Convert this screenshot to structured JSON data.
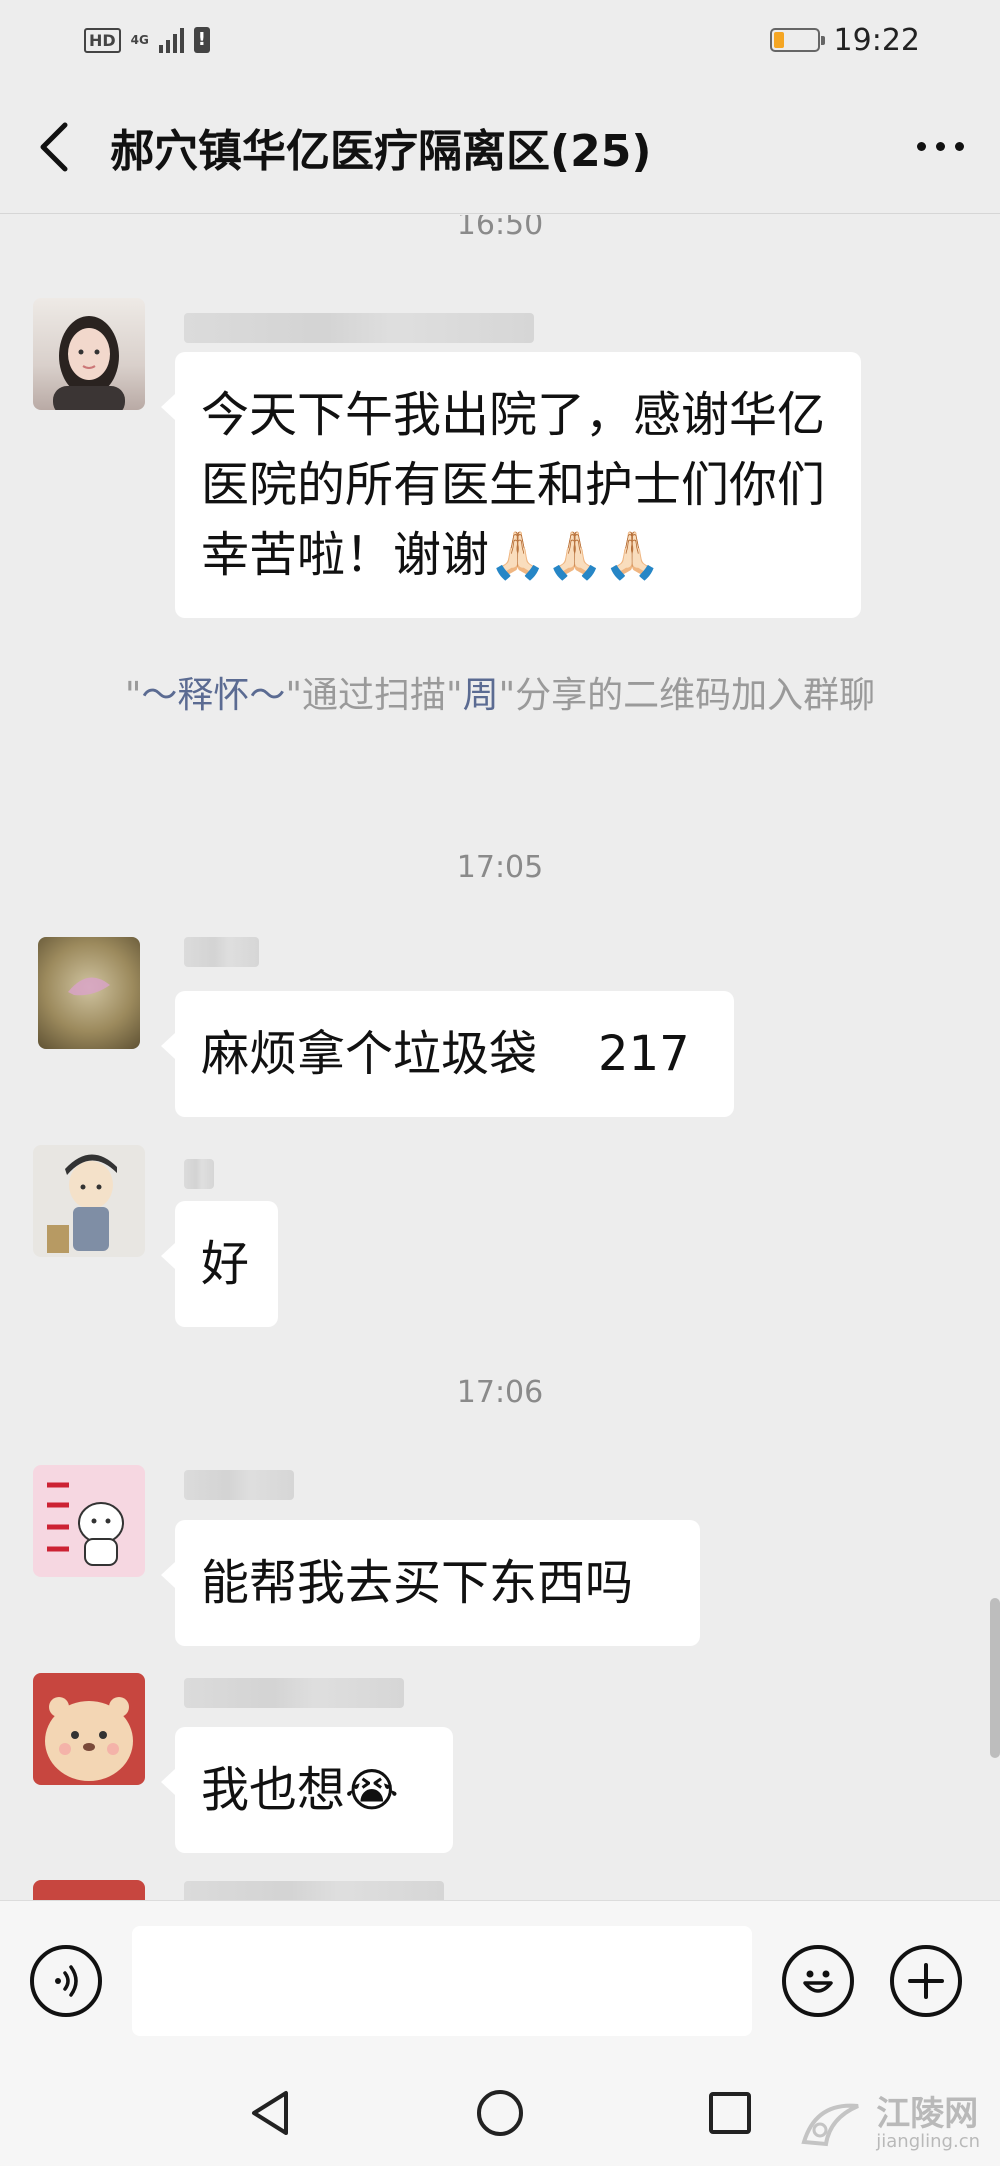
{
  "status_bar": {
    "hd": "HD",
    "network": "4G",
    "warning": "!",
    "time": "19:22",
    "battery_level": 0.25,
    "battery_color": "#f5a623"
  },
  "header": {
    "title": "郝穴镇华亿医疗隔离区(25)",
    "back_icon": "chevron-left-icon",
    "more_icon": "more-dots-icon"
  },
  "messages": {
    "time1": "16:50",
    "msg1": {
      "text": "今天下午我出院了，感谢华亿医院的所有医生和护士们你们幸苦啦！谢谢",
      "emoji": "🙏🏻🙏🏻🙏🏻"
    },
    "system": {
      "q1": "\"",
      "name1": "～释怀～",
      "q2": "\"通过扫描\"",
      "name2": "周",
      "tail": "\"分享的二维码加入群聊"
    },
    "time2": "17:05",
    "msg2": {
      "text": "麻烦拿个垃圾袋    217"
    },
    "msg3": {
      "text": "好"
    },
    "time3": "17:06",
    "msg4": {
      "text": "能帮我去买下东西吗"
    },
    "msg5": {
      "text": "我也想",
      "emoji": "😭"
    }
  },
  "input_bar": {
    "voice_icon": "voice-icon",
    "emoji_icon": "emoji-smile-icon",
    "plus_icon": "plus-icon",
    "placeholder": ""
  },
  "nav_bar": {
    "back_icon": "nav-back-icon",
    "home_icon": "nav-home-icon",
    "recent_icon": "nav-recent-icon"
  },
  "watermark": {
    "name": "江陵网",
    "url": "jiangling.cn"
  }
}
